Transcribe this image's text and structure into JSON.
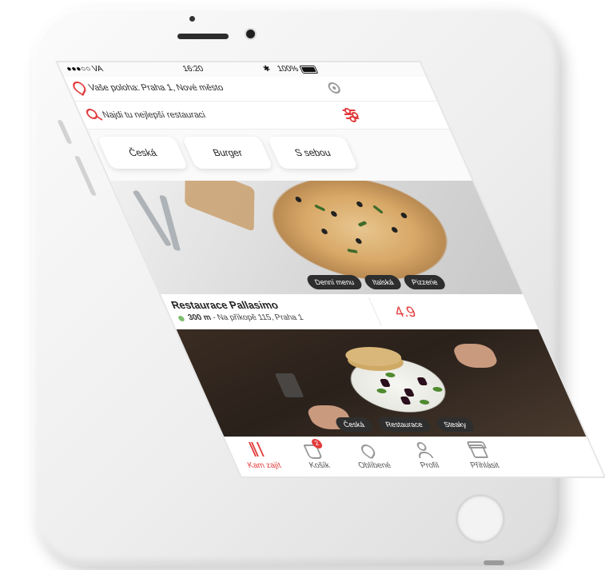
{
  "status_bar": {
    "carrier": "●●●○○ VA",
    "time": "16:20",
    "bluetooth": "✱",
    "battery_pct": "100%"
  },
  "location": {
    "text": "Vaše poloha: Praha 1, Nové město"
  },
  "search": {
    "placeholder": "Najdi tu nejlepší restauraci"
  },
  "categories": [
    "Česká",
    "Burger",
    "S sebou"
  ],
  "restaurants": [
    {
      "name": "Restaurace Pallasimo",
      "distance": "300 m",
      "address": "- Na příkopě 115, Praha 1",
      "rating": "4.9",
      "tags": [
        "Denní menu",
        "Italská",
        "Pizzerie"
      ]
    },
    {
      "tags": [
        "Česká",
        "Restaurace",
        "Steaky"
      ]
    }
  ],
  "tabbar": {
    "items": [
      {
        "label": "Kam zajít",
        "icon": "cutlery-icon",
        "active": true
      },
      {
        "label": "Košík",
        "icon": "bag-icon",
        "badge": "2"
      },
      {
        "label": "Oblíbené",
        "icon": "heart-icon"
      },
      {
        "label": "Profil",
        "icon": "person-icon"
      },
      {
        "label": "Přihlásit",
        "icon": "store-icon"
      }
    ]
  },
  "colors": {
    "accent": "#e23b3b",
    "tag_bg": "#2e2e2e",
    "open_dot": "#7cbf6c"
  }
}
